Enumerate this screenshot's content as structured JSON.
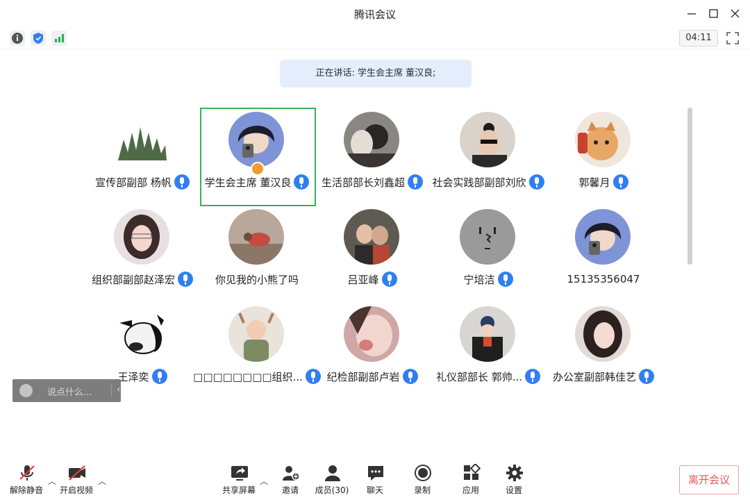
{
  "window": {
    "title": "腾讯会议"
  },
  "toolbar": {
    "timer": "04:11"
  },
  "speaking": {
    "text": "正在讲话: 学生会主席 董汉良;"
  },
  "participants": [
    {
      "name": "宣传部副部 杨帆"
    },
    {
      "name": "学生会主席 董汉良"
    },
    {
      "name": "生活部部长刘鑫超"
    },
    {
      "name": "社会实践部副部刘欣"
    },
    {
      "name": "郭馨月"
    },
    {
      "name": "组织部副部赵泽宏"
    },
    {
      "name": "你见我的小熊了吗"
    },
    {
      "name": "吕亚峰"
    },
    {
      "name": "宁培洁"
    },
    {
      "name": "15135356047"
    },
    {
      "name": "王泽奕"
    },
    {
      "name": "□□□□□□□□组织..."
    },
    {
      "name": "纪检部副部卢岩"
    },
    {
      "name": "礼仪部部长  郭帅..."
    },
    {
      "name": "办公室副部韩佳艺"
    }
  ],
  "chat": {
    "placeholder": "说点什么..."
  },
  "bottom": {
    "unmute": "解除静音",
    "video": "开启视频",
    "share": "共享屏幕",
    "invite": "邀请",
    "members": "成员(30)",
    "chat": "聊天",
    "record": "录制",
    "apps": "应用",
    "settings": "设置",
    "leave": "离开会议"
  },
  "colors": {
    "accent": "#2f7ff3",
    "active_border": "#34b35a",
    "leave": "#e25a5a",
    "signal": "#22b14c"
  }
}
